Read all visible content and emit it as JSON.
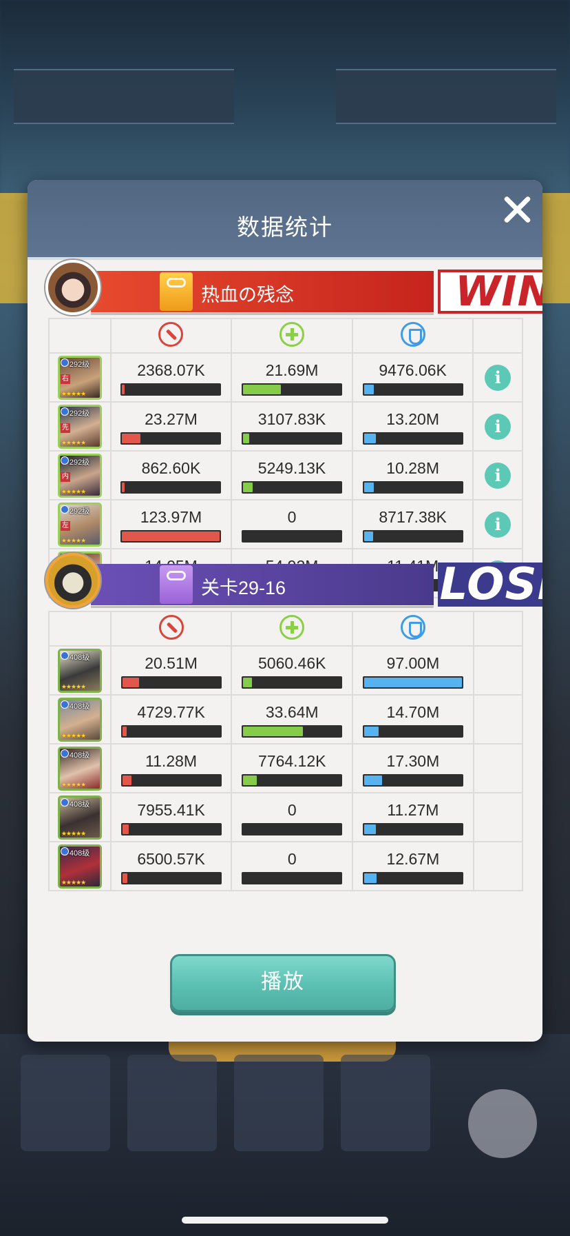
{
  "modal": {
    "title": "数据统计",
    "play_label": "播放"
  },
  "stat_columns": [
    "damage-icon",
    "heal-icon",
    "defense-icon"
  ],
  "team_ally": {
    "name": "热血の残念",
    "result": "WIN",
    "heroes": [
      {
        "level": "292级",
        "position": "右",
        "damage": "2368.07K",
        "heal": "21.69M",
        "defense": "9476.06K",
        "damage_pct": 0.02,
        "heal_pct": 0.39,
        "defense_pct": 0.1
      },
      {
        "level": "292级",
        "position": "先",
        "damage": "23.27M",
        "heal": "3107.83K",
        "defense": "13.20M",
        "damage_pct": 0.19,
        "heal_pct": 0.06,
        "defense_pct": 0.12
      },
      {
        "level": "292级",
        "position": "内",
        "damage": "862.60K",
        "heal": "5249.13K",
        "defense": "10.28M",
        "damage_pct": 0.01,
        "heal_pct": 0.1,
        "defense_pct": 0.1
      },
      {
        "level": "292级",
        "position": "左",
        "damage": "123.97M",
        "heal": "0",
        "defense": "8717.38K",
        "damage_pct": 1.0,
        "heal_pct": 0.0,
        "defense_pct": 0.09
      },
      {
        "level": "292级",
        "position": "内",
        "damage": "14.05M",
        "heal": "54.92M",
        "defense": "11.41M",
        "damage_pct": 0.12,
        "heal_pct": 1.0,
        "defense_pct": 0.11
      }
    ]
  },
  "team_enemy": {
    "name": "关卡29-16",
    "result": "LOSE",
    "heroes": [
      {
        "level": "408级",
        "damage": "20.51M",
        "heal": "5060.46K",
        "defense": "97.00M",
        "damage_pct": 0.17,
        "heal_pct": 0.09,
        "defense_pct": 1.0
      },
      {
        "level": "408级",
        "damage": "4729.77K",
        "heal": "33.64M",
        "defense": "14.70M",
        "damage_pct": 0.04,
        "heal_pct": 0.61,
        "defense_pct": 0.15
      },
      {
        "level": "408级",
        "damage": "11.28M",
        "heal": "7764.12K",
        "defense": "17.30M",
        "damage_pct": 0.09,
        "heal_pct": 0.14,
        "defense_pct": 0.18
      },
      {
        "level": "408级",
        "damage": "7955.41K",
        "heal": "0",
        "defense": "11.27M",
        "damage_pct": 0.06,
        "heal_pct": 0.0,
        "defense_pct": 0.12
      },
      {
        "level": "408级",
        "damage": "6500.57K",
        "heal": "0",
        "defense": "12.67M",
        "damage_pct": 0.05,
        "heal_pct": 0.0,
        "defense_pct": 0.13
      }
    ]
  },
  "colors": {
    "header": "#526781",
    "win": "#c9242a",
    "lose": "#3c3a8c",
    "damage": "#e1574c",
    "heal": "#86cc4a",
    "defense": "#56b3ef",
    "info": "#5cc8b6",
    "play": "#5bbfb2"
  }
}
